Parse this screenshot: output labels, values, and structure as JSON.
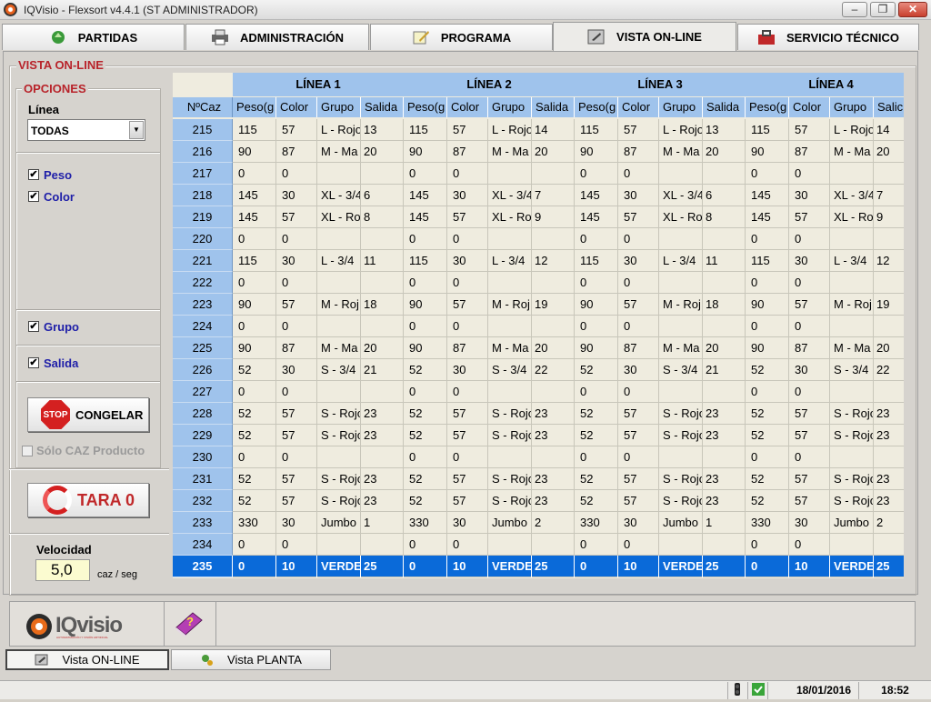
{
  "window": {
    "title": "IQVisio - Flexsort v4.4.1  (ST ADMINISTRADOR)",
    "minimize": "–",
    "maximize": "❐",
    "close": "✕"
  },
  "tabs": [
    {
      "label": "PARTIDAS",
      "icon": "recycle-icon"
    },
    {
      "label": "ADMINISTRACIÓN",
      "icon": "printer-icon"
    },
    {
      "label": "PROGRAMA",
      "icon": "notepad-pencil-icon"
    },
    {
      "label": "VISTA ON-LINE",
      "icon": "monitor-edit-icon",
      "active": true
    },
    {
      "label": "SERVICIO TÉCNICO",
      "icon": "toolbox-icon"
    }
  ],
  "panel_title": "VISTA ON-LINE",
  "options": {
    "title": "OPCIONES",
    "linea_label": "Línea",
    "linea_value": "TODAS",
    "checks": [
      {
        "label": "Peso",
        "checked": true
      },
      {
        "label": "Color",
        "checked": true
      },
      {
        "label": "Grupo",
        "checked": true
      },
      {
        "label": "Salida",
        "checked": true
      }
    ],
    "check_mark": "✔",
    "freeze_button": "CONGELAR",
    "stop_text": "STOP",
    "solo_caz": "Sólo CAZ Producto",
    "tara_button": "TARA 0",
    "velocidad_label": "Velocidad",
    "velocidad_value": "5,0",
    "velocidad_unit": "caz / seg"
  },
  "grid": {
    "lines": [
      "LÍNEA 1",
      "LÍNEA 2",
      "LÍNEA 3",
      "LÍNEA 4"
    ],
    "nr_header": "NºCaz",
    "sub_headers": [
      "Peso(g",
      "Color",
      "Grupo",
      "Salida"
    ],
    "last_sub_headers": [
      "Peso(g",
      "Color",
      "Grupo",
      "Salic"
    ],
    "rows": [
      {
        "n": "215",
        "p": "115",
        "c": "57",
        "g": "L - Rojo",
        "s": [
          "13",
          "14",
          "13",
          "14"
        ]
      },
      {
        "n": "216",
        "p": "90",
        "c": "87",
        "g": "M - Ma",
        "s": [
          "20",
          "20",
          "20",
          "20"
        ]
      },
      {
        "n": "217",
        "p": "0",
        "c": "0",
        "g": "",
        "s": [
          "",
          "",
          "",
          ""
        ]
      },
      {
        "n": "218",
        "p": "145",
        "c": "30",
        "g": "XL - 3/4",
        "s": [
          "6",
          "7",
          "6",
          "7"
        ]
      },
      {
        "n": "219",
        "p": "145",
        "c": "57",
        "g": "XL - Ro",
        "s": [
          "8",
          "9",
          "8",
          "9"
        ]
      },
      {
        "n": "220",
        "p": "0",
        "c": "0",
        "g": "",
        "s": [
          "",
          "",
          "",
          ""
        ]
      },
      {
        "n": "221",
        "p": "115",
        "c": "30",
        "g": "L - 3/4",
        "s": [
          "11",
          "12",
          "11",
          "12"
        ]
      },
      {
        "n": "222",
        "p": "0",
        "c": "0",
        "g": "",
        "s": [
          "",
          "",
          "",
          ""
        ]
      },
      {
        "n": "223",
        "p": "90",
        "c": "57",
        "g": "M - Roj",
        "s": [
          "18",
          "19",
          "18",
          "19"
        ]
      },
      {
        "n": "224",
        "p": "0",
        "c": "0",
        "g": "",
        "s": [
          "",
          "",
          "",
          ""
        ]
      },
      {
        "n": "225",
        "p": "90",
        "c": "87",
        "g": "M - Ma",
        "s": [
          "20",
          "20",
          "20",
          "20"
        ]
      },
      {
        "n": "226",
        "p": "52",
        "c": "30",
        "g": "S - 3/4",
        "s": [
          "21",
          "22",
          "21",
          "22"
        ]
      },
      {
        "n": "227",
        "p": "0",
        "c": "0",
        "g": "",
        "s": [
          "",
          "",
          "",
          ""
        ]
      },
      {
        "n": "228",
        "p": "52",
        "c": "57",
        "g": "S - Rojo",
        "s": [
          "23",
          "23",
          "23",
          "23"
        ]
      },
      {
        "n": "229",
        "p": "52",
        "c": "57",
        "g": "S - Rojo",
        "s": [
          "23",
          "23",
          "23",
          "23"
        ]
      },
      {
        "n": "230",
        "p": "0",
        "c": "0",
        "g": "",
        "s": [
          "",
          "",
          "",
          ""
        ]
      },
      {
        "n": "231",
        "p": "52",
        "c": "57",
        "g": "S - Rojo",
        "s": [
          "23",
          "23",
          "23",
          "23"
        ]
      },
      {
        "n": "232",
        "p": "52",
        "c": "57",
        "g": "S - Rojo",
        "s": [
          "23",
          "23",
          "23",
          "23"
        ]
      },
      {
        "n": "233",
        "p": "330",
        "c": "30",
        "g": "Jumbo",
        "s": [
          "1",
          "2",
          "1",
          "2"
        ]
      },
      {
        "n": "234",
        "p": "0",
        "c": "0",
        "g": "",
        "s": [
          "",
          "",
          "",
          ""
        ]
      },
      {
        "n": "235",
        "p": "0",
        "c": "10",
        "g": "VERDE",
        "s": [
          "25",
          "25",
          "25",
          "25"
        ],
        "selected": true
      }
    ]
  },
  "bottom": {
    "logo_text": "IQvisio",
    "logo_tagline": "AUTOMATIZACIÓN Y VISIÓN ARTIFICIAL",
    "help_mark": "?"
  },
  "bottom_tabs": [
    {
      "label": "Vista ON-LINE",
      "active": true
    },
    {
      "label": "Vista PLANTA",
      "active": false
    }
  ],
  "status": {
    "date": "18/01/2016",
    "time": "18:52"
  },
  "colors": {
    "accent_red": "#b8232a",
    "header_blue": "#9fc3ec",
    "selected_row": "#0a6ad9",
    "check_blue": "#1e1ea8"
  }
}
